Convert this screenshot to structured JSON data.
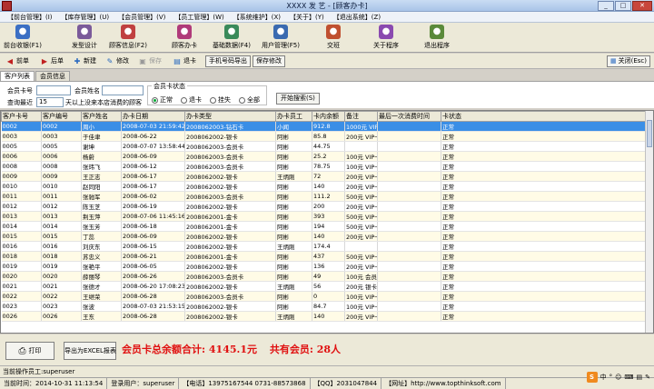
{
  "window": {
    "title": "XXXX 发 艺 - [顾客办卡]",
    "minimize": "_",
    "maximize": "□",
    "close": "✕"
  },
  "menu": [
    "【前台管理】(I)",
    "【库存管理】(U)",
    "【会员管理】(V)",
    "【员工管理】(W)",
    "【系统维护】(X)",
    "【关于】(Y)",
    "【退出系统】(Z)"
  ],
  "big_toolbar": [
    {
      "label": "前台收银(F1)",
      "icon": "cashier-icon",
      "color": "#3b6fc4"
    },
    {
      "label": "发型设计",
      "icon": "hair-design-icon",
      "color": "#7a5a9a"
    },
    {
      "label": "顾客信息(F2)",
      "icon": "customer-info-icon",
      "color": "#c04040"
    },
    {
      "label": "顾客办卡",
      "icon": "card-icon",
      "color": "#b03a7a"
    },
    {
      "label": "基础数据(F4)",
      "icon": "data-icon",
      "color": "#3a8a5a"
    },
    {
      "label": "用户管理(F5)",
      "icon": "user-icon",
      "color": "#3a6ab0"
    },
    {
      "label": "交班",
      "icon": "shift-icon",
      "color": "#c05030"
    },
    {
      "label": "关于程序",
      "icon": "about-icon",
      "color": "#8a4ab0"
    },
    {
      "label": "退出程序",
      "icon": "exit-icon",
      "color": "#5a8a3a"
    }
  ],
  "small_toolbar": {
    "prev": "前单",
    "next": "后单",
    "new": "新建",
    "edit": "修改",
    "save": "保存",
    "refund": "退卡",
    "export_phone": "手机号码导出",
    "save_edit": "保存修改",
    "close": "关闭(Esc)"
  },
  "tabs": [
    "客户列表",
    "会员信息"
  ],
  "filter": {
    "card_no_label": "会员卡号",
    "name_label": "会员姓名",
    "query_label": "查询最近",
    "days_value": "15",
    "days_suffix": "天以上没来本店消费的顾客",
    "status_label": "会员卡状态",
    "status_options": [
      "正常",
      "退卡",
      "挂失",
      "全部"
    ],
    "selected_status": "正常",
    "search_button": "开始搜索(S)"
  },
  "table": {
    "columns": [
      "客户卡号",
      "客户编号",
      "客户姓名",
      "办卡日期",
      "办卡类型",
      "办卡员工",
      "卡内余额",
      "备注",
      "最后一次消费时间",
      "卡状态"
    ],
    "rows": [
      [
        "0002",
        "0002",
        "周小",
        "2008-07-03 21:59:42",
        "2008062003-钻石卡",
        "小闻",
        "912.8",
        "1000元 VIP卡",
        "",
        "正常"
      ],
      [
        "0003",
        "0003",
        "于佳聿",
        "2008-06-22",
        "2008062002-银卡",
        "阿彬",
        "85.8",
        "200元 VIP卡",
        "",
        "正常"
      ],
      [
        "0005",
        "0005",
        "谢坤",
        "2008-07-07 13:58:44",
        "2008062003-会员卡",
        "阿彬",
        "44.75",
        "",
        "",
        "正常"
      ],
      [
        "0006",
        "0006",
        "杨蔚",
        "2008-06-09",
        "2008062003-会员卡",
        "阿彬",
        "25.2",
        "100元 VIP卡",
        "",
        "正常"
      ],
      [
        "0008",
        "0008",
        "张玮飞",
        "2008-06-12",
        "2008062003-会员卡",
        "阿彬",
        "78.75",
        "100元 VIP卡",
        "",
        "正常"
      ],
      [
        "0009",
        "0009",
        "王正志",
        "2008-06-17",
        "2008062002-银卡",
        "王炳刚",
        "72",
        "200元 VIP卡",
        "",
        "正常"
      ],
      [
        "0010",
        "0010",
        "赵同阳",
        "2008-06-17",
        "2008062002-银卡",
        "阿彬",
        "140",
        "200元 VIP卡",
        "",
        "正常"
      ],
      [
        "0011",
        "0011",
        "张驰军",
        "2008-06-02",
        "2008062003-会员卡",
        "阿彬",
        "111.2",
        "500元 VIP卡",
        "",
        "正常"
      ],
      [
        "0012",
        "0012",
        "陈玉芝",
        "2008-06-19",
        "2008062002-银卡",
        "阿彬",
        "200",
        "200元 VIP卡",
        "",
        "正常"
      ],
      [
        "0013",
        "0013",
        "荆玉萍",
        "2008-07-06 11:45:16",
        "2008062001-金卡",
        "阿彬",
        "393",
        "500元 VIP卡",
        "",
        "正常"
      ],
      [
        "0014",
        "0014",
        "张玉芳",
        "2008-06-18",
        "2008062001-金卡",
        "阿彬",
        "194",
        "500元 VIP卡",
        "",
        "正常"
      ],
      [
        "0015",
        "0015",
        "丁蕊",
        "2008-06-09",
        "2008062002-银卡",
        "阿彬",
        "140",
        "200元 VIP卡",
        "",
        "正常"
      ],
      [
        "0016",
        "0016",
        "刘庆东",
        "2008-06-15",
        "2008062002-银卡",
        "王炳刚",
        "174.4",
        "",
        "",
        "正常"
      ],
      [
        "0018",
        "0018",
        "苏忠义",
        "2008-06-21",
        "2008062001-金卡",
        "阿彬",
        "437",
        "500元 VIP卡",
        "",
        "正常"
      ],
      [
        "0019",
        "0019",
        "张艳平",
        "2008-06-05",
        "2008062002-银卡",
        "阿彬",
        "136",
        "200元 VIP卡",
        "",
        "正常"
      ],
      [
        "0020",
        "0020",
        "薛丽琴",
        "2008-06-26",
        "2008062003-会员卡",
        "阿彬",
        "49",
        "100元 会员卡",
        "",
        "正常"
      ],
      [
        "0021",
        "0021",
        "张德才",
        "2008-06-20 17:08:23",
        "2008062002-银卡",
        "王炳刚",
        "56",
        "200元 银卡",
        "",
        "正常"
      ],
      [
        "0022",
        "0022",
        "王继荣",
        "2008-06-28",
        "2008062003-会员卡",
        "阿彬",
        "0",
        "100元 VIP卡",
        "",
        "正常"
      ],
      [
        "0023",
        "0023",
        "张波",
        "2008-07-03 21:53:15",
        "2008062002-银卡",
        "阿彬",
        "84.7",
        "100元 VIP卡",
        "",
        "正常"
      ],
      [
        "0026",
        "0026",
        "王东",
        "2008-06-28",
        "2008062002-银卡",
        "王炳刚",
        "140",
        "200元 VIP卡",
        "",
        "正常"
      ]
    ],
    "selected_index": 0
  },
  "bottom": {
    "print": "打印",
    "excel": "导出为EXCEL报表",
    "summary_balance": "会员卡总余额合计: 4145.1元",
    "summary_count": "共有会员: 28人"
  },
  "operator": "当前操作员工:superuser",
  "statusbar": [
    "当前时间：2014-10-31 11:13:54",
    "登录用户：superuser",
    "【电话】13975167544  0731-88573868",
    "【QQ】2031047844",
    "【网址】http://www.topthinksoft.com"
  ],
  "tray": {
    "logo": "S",
    "items": [
      "中",
      "°",
      "☺",
      "⌨",
      "▤",
      "✎"
    ]
  }
}
